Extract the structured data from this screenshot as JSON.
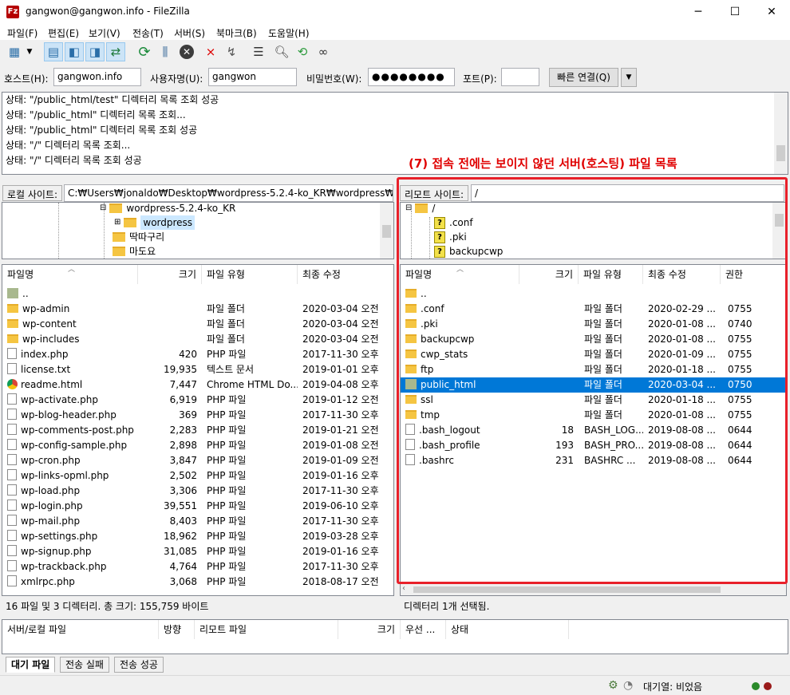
{
  "window": {
    "title": "gangwon@gangwon.info - FileZilla",
    "app_icon": "Fz",
    "minimize": "─",
    "maximize": "☐",
    "close": "✕"
  },
  "menu": [
    "파일(F)",
    "편집(E)",
    "보기(V)",
    "전송(T)",
    "서버(S)",
    "북마크(B)",
    "도움말(H)"
  ],
  "toolbar_icons": [
    "site-manager-icon",
    "dropdown-icon",
    "toggle-log-icon",
    "toggle-local-tree-icon",
    "toggle-remote-tree-icon",
    "toggle-queue-icon",
    "refresh-icon",
    "process-queue-icon",
    "cancel-icon",
    "disconnect-icon",
    "reconnect-icon",
    "filter-icon",
    "compare-icon",
    "sync-browse-icon",
    "search-icon"
  ],
  "quickconnect": {
    "host_label": "호스트(H):",
    "host_value": "gangwon.info",
    "user_label": "사용자명(U):",
    "user_value": "gangwon",
    "pass_label": "비밀번호(W):",
    "pass_value": "●●●●●●●●",
    "port_label": "포트(P):",
    "port_value": "",
    "connect_button": "빠른 연결(Q)",
    "dropdown": "▼"
  },
  "log": [
    "상태:   \"/public_html/test\" 디렉터리 목록 조회 성공",
    "상태:   \"/public_html\" 디렉터리 목록 조회...",
    "상태:   \"/public_html\" 디렉터리 목록 조회 성공",
    "상태:   \"/\" 디렉터리 목록 조회...",
    "상태:   \"/\" 디렉터리 목록 조회 성공"
  ],
  "annotation": "(7) 접속 전에는 보이지 않던 서버(호스팅) 파일 목록",
  "local": {
    "site_label": "로컬 사이트:",
    "site_path": "C:₩Users₩jonaldo₩Desktop₩wordpress-5.2.4-ko_KR₩wordpress₩",
    "tree": [
      "wordpress-5.2.4-ko_KR",
      "wordpress",
      "딱따구리",
      "마도요"
    ],
    "headers": [
      "파일명",
      "크기",
      "파일 유형",
      "최종 수정"
    ],
    "files": [
      {
        "name": "..",
        "size": "",
        "type": "",
        "date": "",
        "icon": "up"
      },
      {
        "name": "wp-admin",
        "size": "",
        "type": "파일 폴더",
        "date": "2020-03-04 오전 ...",
        "icon": "folder"
      },
      {
        "name": "wp-content",
        "size": "",
        "type": "파일 폴더",
        "date": "2020-03-04 오전 ...",
        "icon": "folder"
      },
      {
        "name": "wp-includes",
        "size": "",
        "type": "파일 폴더",
        "date": "2020-03-04 오전 ...",
        "icon": "folder"
      },
      {
        "name": "index.php",
        "size": "420",
        "type": "PHP 파일",
        "date": "2017-11-30 오후 ...",
        "icon": "file"
      },
      {
        "name": "license.txt",
        "size": "19,935",
        "type": "텍스트 문서",
        "date": "2019-01-01 오후 ...",
        "icon": "file"
      },
      {
        "name": "readme.html",
        "size": "7,447",
        "type": "Chrome HTML Do...",
        "date": "2019-04-08 오후 ...",
        "icon": "chrome"
      },
      {
        "name": "wp-activate.php",
        "size": "6,919",
        "type": "PHP 파일",
        "date": "2019-01-12 오전 ...",
        "icon": "file"
      },
      {
        "name": "wp-blog-header.php",
        "size": "369",
        "type": "PHP 파일",
        "date": "2017-11-30 오후 ...",
        "icon": "file"
      },
      {
        "name": "wp-comments-post.php",
        "size": "2,283",
        "type": "PHP 파일",
        "date": "2019-01-21 오전 ...",
        "icon": "file"
      },
      {
        "name": "wp-config-sample.php",
        "size": "2,898",
        "type": "PHP 파일",
        "date": "2019-01-08 오전 ...",
        "icon": "file"
      },
      {
        "name": "wp-cron.php",
        "size": "3,847",
        "type": "PHP 파일",
        "date": "2019-01-09 오전 ...",
        "icon": "file"
      },
      {
        "name": "wp-links-opml.php",
        "size": "2,502",
        "type": "PHP 파일",
        "date": "2019-01-16 오후 ...",
        "icon": "file"
      },
      {
        "name": "wp-load.php",
        "size": "3,306",
        "type": "PHP 파일",
        "date": "2017-11-30 오후 ...",
        "icon": "file"
      },
      {
        "name": "wp-login.php",
        "size": "39,551",
        "type": "PHP 파일",
        "date": "2019-06-10 오후 ...",
        "icon": "file"
      },
      {
        "name": "wp-mail.php",
        "size": "8,403",
        "type": "PHP 파일",
        "date": "2017-11-30 오후 ...",
        "icon": "file"
      },
      {
        "name": "wp-settings.php",
        "size": "18,962",
        "type": "PHP 파일",
        "date": "2019-03-28 오후 ...",
        "icon": "file"
      },
      {
        "name": "wp-signup.php",
        "size": "31,085",
        "type": "PHP 파일",
        "date": "2019-01-16 오후 ...",
        "icon": "file"
      },
      {
        "name": "wp-trackback.php",
        "size": "4,764",
        "type": "PHP 파일",
        "date": "2017-11-30 오후 ...",
        "icon": "file"
      },
      {
        "name": "xmlrpc.php",
        "size": "3,068",
        "type": "PHP 파일",
        "date": "2018-08-17 오전 ...",
        "icon": "file"
      }
    ],
    "status": "16 파일 및 3 디렉터리. 총 크기: 155,759 바이트"
  },
  "remote": {
    "site_label": "리모트 사이트:",
    "site_path": "/",
    "tree": [
      "/",
      ".conf",
      ".pki",
      "backupcwp"
    ],
    "headers": [
      "파일명",
      "크기",
      "파일 유형",
      "최종 수정",
      "권한"
    ],
    "files": [
      {
        "name": "..",
        "size": "",
        "type": "",
        "date": "",
        "perm": "",
        "icon": "folder"
      },
      {
        "name": ".conf",
        "size": "",
        "type": "파일 폴더",
        "date": "2020-02-29 ...",
        "perm": "0755",
        "icon": "folder"
      },
      {
        "name": ".pki",
        "size": "",
        "type": "파일 폴더",
        "date": "2020-01-08 ...",
        "perm": "0740",
        "icon": "folder"
      },
      {
        "name": "backupcwp",
        "size": "",
        "type": "파일 폴더",
        "date": "2020-01-08 ...",
        "perm": "0755",
        "icon": "folder"
      },
      {
        "name": "cwp_stats",
        "size": "",
        "type": "파일 폴더",
        "date": "2020-01-09 ...",
        "perm": "0755",
        "icon": "folder"
      },
      {
        "name": "ftp",
        "size": "",
        "type": "파일 폴더",
        "date": "2020-01-18 ...",
        "perm": "0755",
        "icon": "folder"
      },
      {
        "name": "public_html",
        "size": "",
        "type": "파일 폴더",
        "date": "2020-03-04 ...",
        "perm": "0750",
        "icon": "up",
        "selected": true
      },
      {
        "name": "ssl",
        "size": "",
        "type": "파일 폴더",
        "date": "2020-01-18 ...",
        "perm": "0755",
        "icon": "folder"
      },
      {
        "name": "tmp",
        "size": "",
        "type": "파일 폴더",
        "date": "2020-01-08 ...",
        "perm": "0755",
        "icon": "folder"
      },
      {
        "name": ".bash_logout",
        "size": "18",
        "type": "BASH_LOG...",
        "date": "2019-08-08 ...",
        "perm": "0644",
        "icon": "file"
      },
      {
        "name": ".bash_profile",
        "size": "193",
        "type": "BASH_PRO...",
        "date": "2019-08-08 ...",
        "perm": "0644",
        "icon": "file"
      },
      {
        "name": ".bashrc",
        "size": "231",
        "type": "BASHRC ...",
        "date": "2019-08-08 ...",
        "perm": "0644",
        "icon": "file"
      }
    ],
    "status": "디렉터리 1개 선택됨."
  },
  "queue": {
    "headers": [
      "서버/로컬 파일",
      "방향",
      "리모트 파일",
      "크기",
      "우선 ...",
      "상태"
    ],
    "tabs": [
      "대기 파일",
      "전송 실패",
      "전송 성공"
    ]
  },
  "statusbar": {
    "queue_text": "대기열: 비었음"
  }
}
